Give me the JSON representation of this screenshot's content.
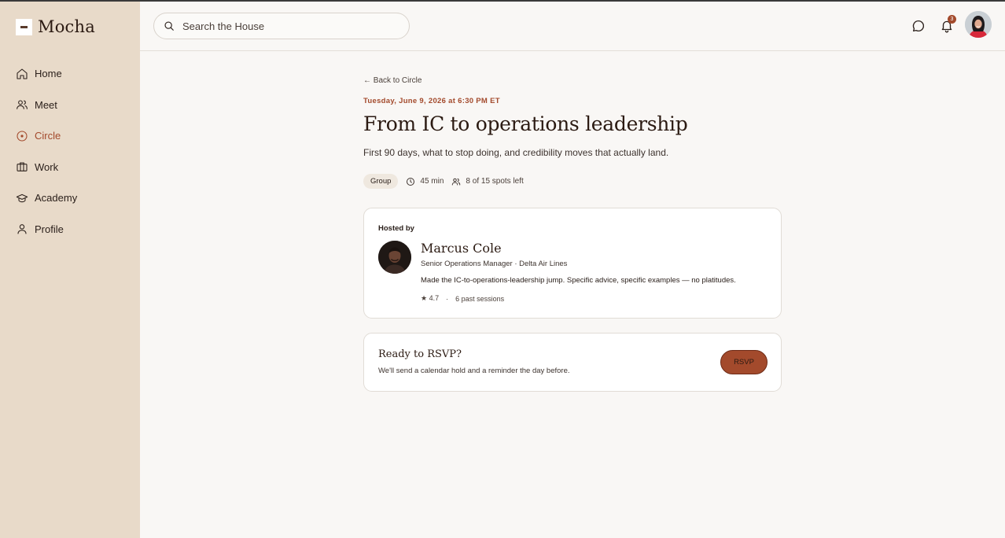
{
  "app": {
    "name": "Mocha"
  },
  "sidebar": {
    "items": [
      {
        "label": "Home",
        "icon": "home-icon"
      },
      {
        "label": "Meet",
        "icon": "users-icon"
      },
      {
        "label": "Circle",
        "icon": "circle-icon",
        "active": true
      },
      {
        "label": "Work",
        "icon": "briefcase-icon"
      },
      {
        "label": "Academy",
        "icon": "graduation-cap-icon"
      },
      {
        "label": "Profile",
        "icon": "user-icon"
      }
    ]
  },
  "header": {
    "search_placeholder": "Search the House",
    "notification_count": "3"
  },
  "event": {
    "back_label": "← Back to Circle",
    "date": "Tuesday, June 9, 2026 at 6:30 PM ET",
    "title": "From IC to operations leadership",
    "subtitle": "First 90 days, what to stop doing, and credibility moves that actually land.",
    "type": "Group",
    "duration": "45 min",
    "spots": "8 of 15 spots left"
  },
  "host": {
    "heading": "Hosted by",
    "name": "Marcus Cole",
    "role": "Senior Operations Manager · Delta Air Lines",
    "bio": "Made the IC-to-operations-leadership jump. Specific advice, specific examples — no platitudes.",
    "rating": "★ 4.7",
    "separator": "·",
    "sessions": "6 past sessions"
  },
  "rsvp": {
    "title": "Ready to RSVP?",
    "subtitle": "We'll send a calendar hold and a reminder the day before.",
    "button_label": "RSVP"
  },
  "colors": {
    "accent": "#a34a2c",
    "sidebar_bg": "#e8dac9",
    "page_bg": "#f9f7f5"
  }
}
